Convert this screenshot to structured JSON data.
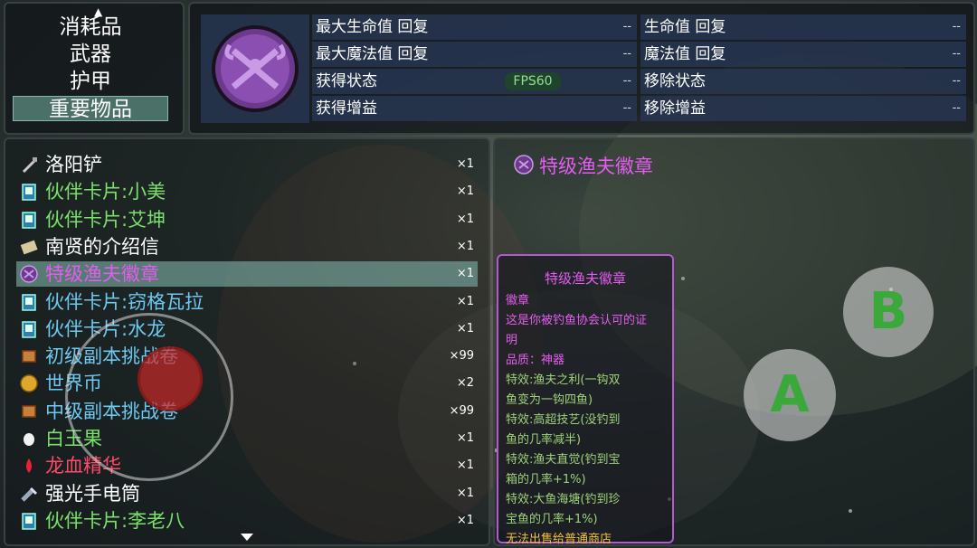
{
  "categories": {
    "items": [
      "消耗品",
      "武器",
      "护甲",
      "重要物品"
    ],
    "selected_index": 3
  },
  "stats": {
    "rows": [
      {
        "label": "最大生命值 回复",
        "value": "--"
      },
      {
        "label": "生命值 回复",
        "value": "--"
      },
      {
        "label": "最大魔法值 回复",
        "value": "--"
      },
      {
        "label": "魔法值 回复",
        "value": "--"
      },
      {
        "label": "获得状态",
        "value": "--"
      },
      {
        "label": "移除状态",
        "value": "--"
      },
      {
        "label": "获得增益",
        "value": "--"
      },
      {
        "label": "移除增益",
        "value": "--"
      }
    ],
    "fps": "FPS60"
  },
  "items": [
    {
      "name": "洛阳铲",
      "count": "×1",
      "color": "#ffffff",
      "icon": "shovel-icon"
    },
    {
      "name": "伙伴卡片:小美",
      "count": "×1",
      "color": "#7be06c",
      "icon": "partner-card-icon"
    },
    {
      "name": "伙伴卡片:艾坤",
      "count": "×1",
      "color": "#7be06c",
      "icon": "partner-card-icon"
    },
    {
      "name": "南贤的介绍信",
      "count": "×1",
      "color": "#ffffff",
      "icon": "letter-icon"
    },
    {
      "name": "特级渔夫徽章",
      "count": "×1",
      "color": "#e45cf0",
      "icon": "badge-icon"
    },
    {
      "name": "伙伴卡片:窃格瓦拉",
      "count": "×1",
      "color": "#6ec8f0",
      "icon": "partner-card-icon"
    },
    {
      "name": "伙伴卡片:水龙",
      "count": "×1",
      "color": "#6ec8f0",
      "icon": "partner-card-icon"
    },
    {
      "name": "初级副本挑战卷",
      "count": "×99",
      "color": "#6ec8f0",
      "icon": "scroll-icon"
    },
    {
      "name": "世界币",
      "count": "×2",
      "color": "#6ec8f0",
      "icon": "coin-icon"
    },
    {
      "name": "中级副本挑战卷",
      "count": "×99",
      "color": "#6ec8f0",
      "icon": "scroll-icon"
    },
    {
      "name": "白玉果",
      "count": "×1",
      "color": "#7be06c",
      "icon": "fruit-icon"
    },
    {
      "name": "龙血精华",
      "count": "×1",
      "color": "#ff4a6a",
      "icon": "blood-drop-icon"
    },
    {
      "name": "强光手电筒",
      "count": "×1",
      "color": "#ffffff",
      "icon": "flashlight-icon"
    },
    {
      "name": "伙伴卡片:李老八",
      "count": "×1",
      "color": "#7be06c",
      "icon": "partner-card-icon"
    }
  ],
  "selected_item_index": 4,
  "detail": {
    "title": "特级渔夫徽章",
    "tooltip_title": "特级渔夫徽章",
    "lines": [
      {
        "text": "徽章",
        "color": "#e45cf0"
      },
      {
        "text": "这是你被钓鱼协会认可的证",
        "color": "#e45cf0"
      },
      {
        "text": "明",
        "color": "#e45cf0"
      },
      {
        "text": "品质：神器",
        "color": "#e45cf0"
      },
      {
        "text": "特效:渔夫之利(一钩双",
        "color": "#9fd27a"
      },
      {
        "text": "鱼变为一钩四鱼)",
        "color": "#9fd27a"
      },
      {
        "text": "特效:高超技艺(没钓到",
        "color": "#9fd27a"
      },
      {
        "text": "鱼的几率减半)",
        "color": "#9fd27a"
      },
      {
        "text": "特效:渔夫直觉(钓到宝",
        "color": "#9fd27a"
      },
      {
        "text": "箱的几率+1%)",
        "color": "#9fd27a"
      },
      {
        "text": "特效:大鱼海塘(钓到珍",
        "color": "#9fd27a"
      },
      {
        "text": "宝鱼的几率+1%)",
        "color": "#9fd27a"
      },
      {
        "text": "无法出售给普通商店",
        "color": "#f0c040"
      }
    ]
  },
  "controls": {
    "button_b": "B",
    "button_a": "A"
  }
}
